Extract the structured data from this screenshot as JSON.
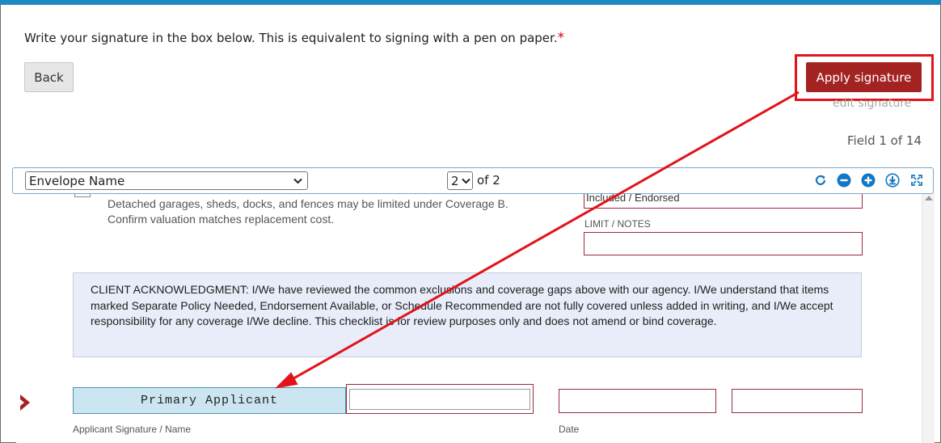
{
  "instruction": {
    "text": "Write your signature in the box below. This is equivalent to signing with a pen on paper.",
    "required_mark": "*"
  },
  "buttons": {
    "back": "Back",
    "apply": "Apply signature",
    "edit_signature": "edit signature"
  },
  "field_counter": "Field 1 of 14",
  "viewer": {
    "envelope_select": "Envelope Name",
    "page_select": "2",
    "page_of": "of 2",
    "tools": [
      "rotate-icon",
      "zoom-out-icon",
      "zoom-in-icon",
      "download-icon",
      "fullscreen-icon"
    ]
  },
  "document": {
    "coverage_note_line1": "Detached garages, sheds, docks, and fences may be limited under Coverage B.",
    "coverage_note_line2": "Confirm valuation matches replacement cost.",
    "included_value": "Included / Endorsed",
    "limit_label": "LIMIT / NOTES",
    "acknowledgment": "CLIENT ACKNOWLEDGMENT: I/We have reviewed the common exclusions and coverage gaps above with our agency. I/We understand that items marked Separate Policy Needed, Endorsement Available, or Schedule Recommended are not fully covered unless added in writing, and I/We accept responsibility for any coverage I/We decline. This checklist is for review purposes only and does not amend or bind coverage.",
    "primary_field_label": "Primary Applicant",
    "applicant_caption": "Applicant Signature / Name",
    "date_caption": "Date"
  },
  "colors": {
    "accent_bar": "#1f8ac0",
    "apply_button": "#a32222",
    "highlight": "#e2131b",
    "field_border": "#9a2b3a",
    "active_field": "#cce6f1",
    "ack_background": "#e8edf9"
  }
}
